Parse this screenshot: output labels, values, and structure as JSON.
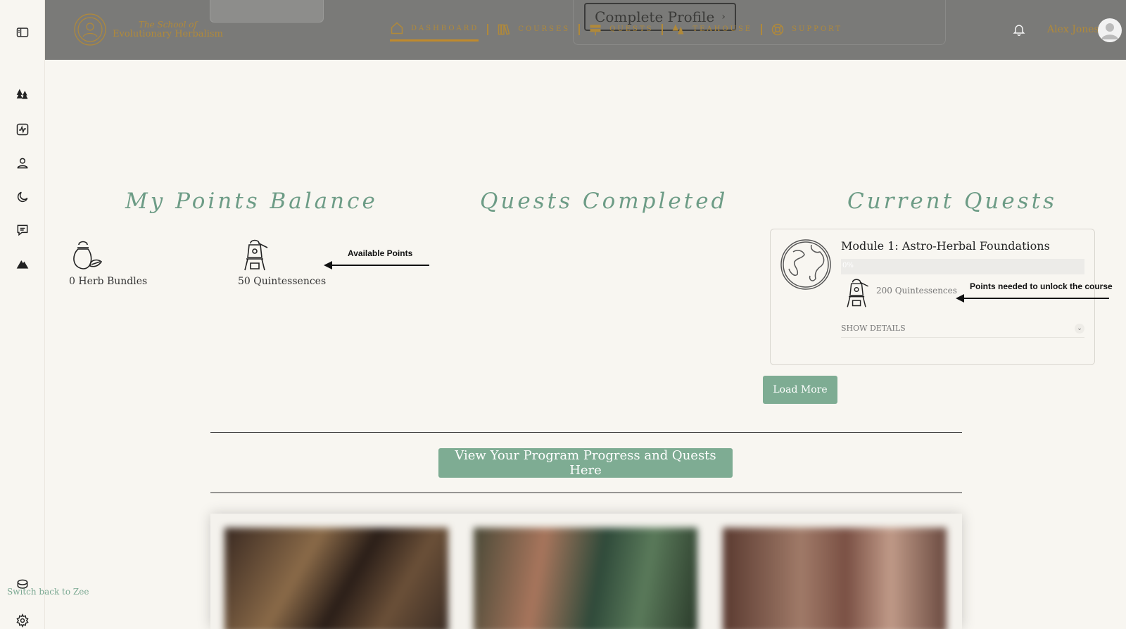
{
  "header": {
    "logo_line1": "The School of",
    "logo_line2": "Evolutionary Herbalism",
    "complete_profile_label": "Complete Profile",
    "nav": [
      {
        "label": "DASHBOARD",
        "icon": "home-icon"
      },
      {
        "label": "COURSES",
        "icon": "books-icon"
      },
      {
        "label": "QUESTS",
        "icon": "signpost-icon"
      },
      {
        "label": "TEAHOUSE",
        "icon": "trees-icon"
      },
      {
        "label": "SUPPORT",
        "icon": "support-icon"
      }
    ],
    "user_name": "Alex Jones"
  },
  "sidebar": {
    "icons": [
      "sidebar-toggle-icon",
      "forest-icon",
      "activity-icon",
      "user-icon",
      "moon-icon",
      "chat-icon",
      "mountain-icon"
    ],
    "switch_back": "Switch back to Zee"
  },
  "points_balance": {
    "title": "My Points Balance",
    "items": [
      {
        "label": "0 Herb Bundles"
      },
      {
        "label": "50 Quintessences"
      }
    ],
    "annotation": "Available Points"
  },
  "quests_completed": {
    "title": "Quests Completed"
  },
  "current_quests": {
    "title": "Current Quests",
    "card": {
      "title": "Module 1: Astro-Herbal Foundations",
      "progress_label": "0%",
      "progress": 0,
      "points_label": "200 Quintessences",
      "details_label": "SHOW DETAILS"
    },
    "annotation": "Points needed to unlock the course",
    "load_more": "Load More"
  },
  "program_progress_button": "View Your Program Progress and Quests Here",
  "colors": {
    "accent_green": "#7eac93",
    "title_green": "#6d9c86",
    "gold": "#b0893a",
    "header_overlay": "#7a7a78"
  }
}
